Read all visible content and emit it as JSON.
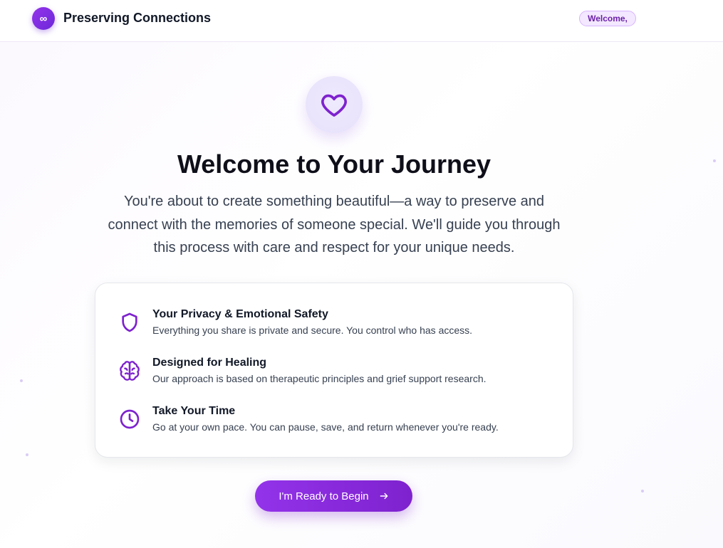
{
  "header": {
    "logo_glyph": "∞",
    "brand": "Preserving Connections",
    "welcome_badge": "Welcome,"
  },
  "hero": {
    "icon": "heart-icon",
    "title": "Welcome to Your Journey",
    "intro": "You're about to create something beautiful—a way to preserve and connect with the memories of someone special. We'll guide you through this process with care and respect for your unique needs."
  },
  "features": [
    {
      "icon": "shield-icon",
      "title": "Your Privacy & Emotional Safety",
      "description": "Everything you share is private and secure. You control who has access."
    },
    {
      "icon": "brain-icon",
      "title": "Designed for Healing",
      "description": "Our approach is based on therapeutic principles and grief support research."
    },
    {
      "icon": "clock-icon",
      "title": "Take Your Time",
      "description": "Go at your own pace. You can pause, save, and return whenever you're ready."
    }
  ],
  "cta": {
    "label": "I'm Ready to Begin",
    "icon": "arrow-right-icon"
  },
  "colors": {
    "accent": "#7e22ce",
    "accent_light": "#9333ea",
    "badge_bg": "#f3e8ff",
    "text_dark": "#111827",
    "text_body": "#374151"
  }
}
